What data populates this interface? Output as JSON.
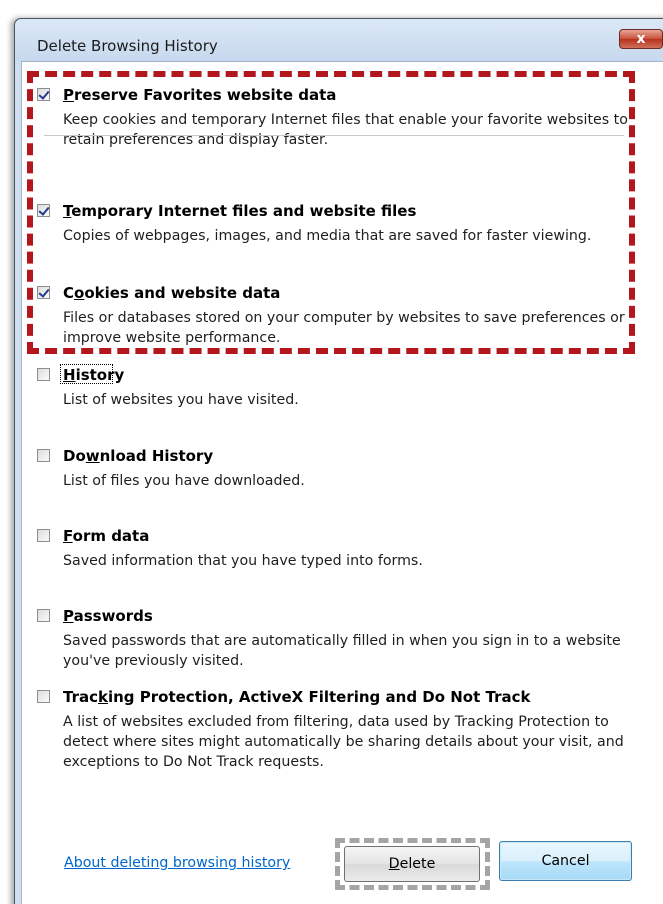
{
  "window": {
    "title": "Delete Browsing History",
    "close_label": "x"
  },
  "options": [
    {
      "title_pre": "",
      "title_key": "P",
      "title_post": "reserve Favorites website data",
      "checked": true,
      "description": "Keep cookies and temporary Internet files that enable your favorite websites to retain preferences and display faster."
    },
    {
      "title_pre": "",
      "title_key": "T",
      "title_post": "emporary Internet files and website files",
      "checked": true,
      "description": "Copies of webpages, images, and media that are saved for faster viewing."
    },
    {
      "title_pre": "C",
      "title_key": "o",
      "title_post": "okies and website data",
      "checked": true,
      "description": "Files or databases stored on your computer by websites to save preferences or improve website performance."
    },
    {
      "title_pre": "",
      "title_key": "H",
      "title_post": "istory",
      "checked": false,
      "description": "List of websites you have visited."
    },
    {
      "title_pre": "Do",
      "title_key": "w",
      "title_post": "nload History",
      "checked": false,
      "description": "List of files you have downloaded."
    },
    {
      "title_pre": "",
      "title_key": "F",
      "title_post": "orm data",
      "checked": false,
      "description": "Saved information that you have typed into forms."
    },
    {
      "title_pre": "",
      "title_key": "P",
      "title_post": "asswords",
      "checked": false,
      "description": "Saved passwords that are automatically filled in when you sign in to a website you've previously visited."
    },
    {
      "title_pre": "Trac",
      "title_key": "k",
      "title_post": "ing Protection, ActiveX Filtering and Do Not Track",
      "checked": false,
      "description": "A list of websites excluded from filtering, data used by Tracking Protection to detect where sites might automatically be sharing details about your visit, and exceptions to Do Not Track requests."
    }
  ],
  "footer": {
    "link_text": "About deleting browsing history",
    "delete_pre": "",
    "delete_key": "D",
    "delete_post": "elete",
    "cancel_label": "Cancel"
  },
  "colors": {
    "highlight_red": "#b3161c",
    "highlight_gray": "#a5a5a5",
    "link": "#0066cc",
    "checkmark": "#24398c"
  }
}
